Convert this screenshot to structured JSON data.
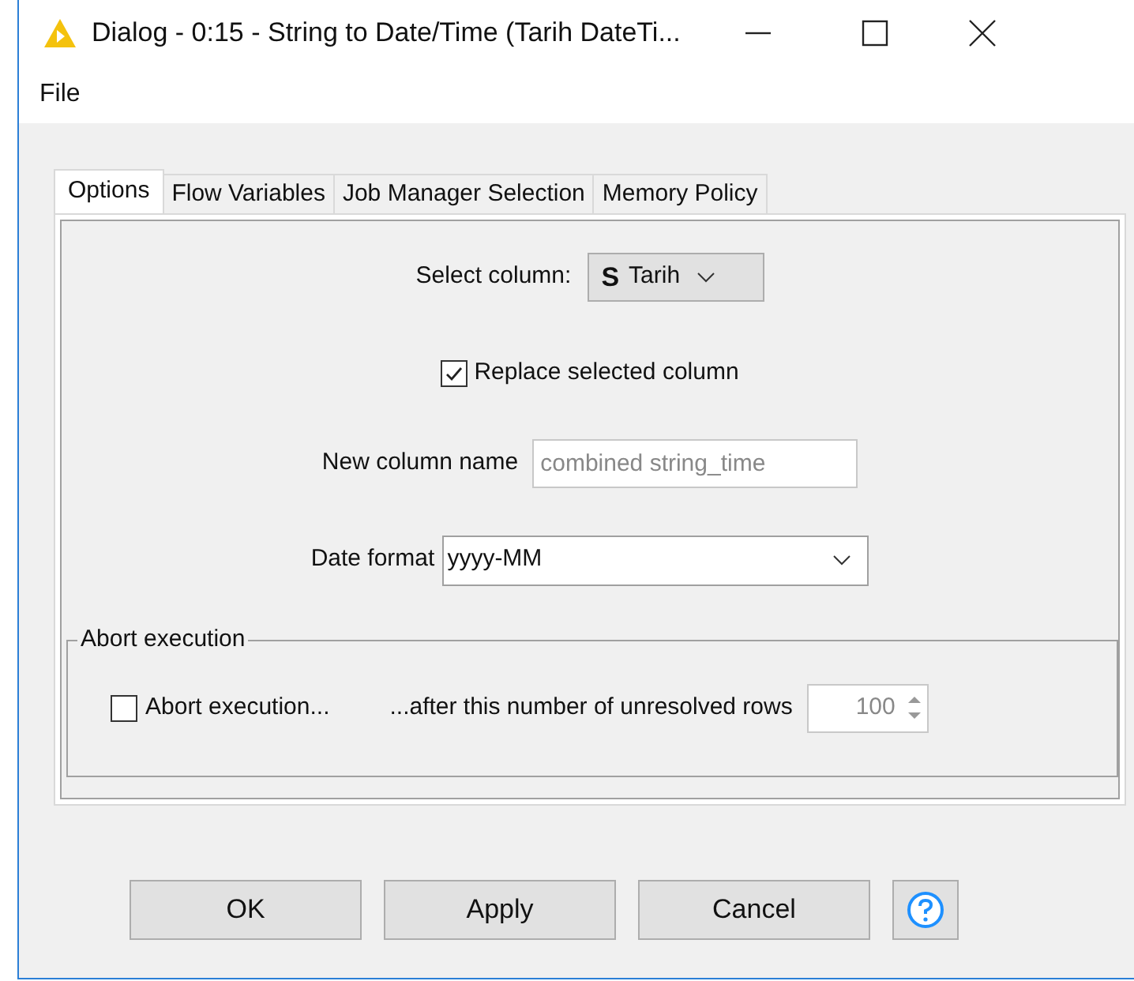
{
  "window": {
    "title": "Dialog - 0:15 - String to Date/Time (Tarih DateTi..."
  },
  "menu": [
    "File"
  ],
  "tabs": [
    {
      "label": "Options",
      "selected": true
    },
    {
      "label": "Flow Variables",
      "selected": false
    },
    {
      "label": "Job Manager Selection",
      "selected": false
    },
    {
      "label": "Memory Policy",
      "selected": false
    }
  ],
  "select_column": {
    "label": "Select column:",
    "type_badge": "S",
    "value": "Tarih"
  },
  "replace_column": {
    "label": "Replace selected column",
    "checked": true
  },
  "new_column_name": {
    "label": "New column name",
    "placeholder": "combined string_time",
    "disabled": true
  },
  "date_format": {
    "label": "Date format",
    "value": "yyyy-MM"
  },
  "abort_group": {
    "title": "Abort execution",
    "checkbox": {
      "label": "Abort execution...",
      "checked": false
    },
    "rows_label": "...after this number of unresolved rows",
    "rows_value": "100",
    "disabled": true
  },
  "buttons": [
    "OK",
    "Apply",
    "Cancel"
  ]
}
